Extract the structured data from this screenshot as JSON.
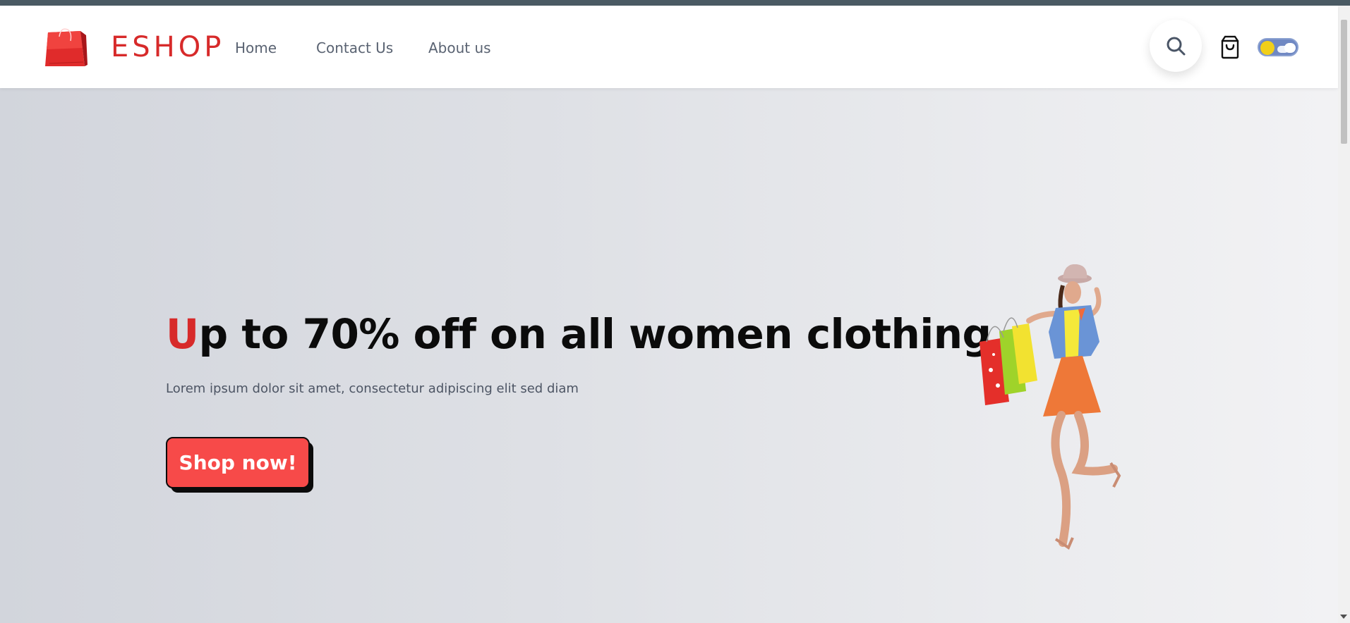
{
  "brand": {
    "name": "ESHOP",
    "logo_icon": "shopping-bag-icon",
    "color": "#d72a2a"
  },
  "nav": {
    "items": [
      {
        "label": "Home"
      },
      {
        "label": "Contact Us"
      },
      {
        "label": "About us"
      }
    ]
  },
  "header_actions": {
    "search_icon": "search-icon",
    "cart_icon": "cart-bag-icon",
    "theme_toggle": {
      "icon": "sun-cloud-toggle",
      "state": "light"
    }
  },
  "hero": {
    "headline_first_letter": "U",
    "headline_rest": "p to 70% off on all women clothing",
    "subtext": "Lorem ipsum dolor sit amet, consectetur adipiscing elit sed diam",
    "cta_label": "Shop now!",
    "cta_color": "#f74a49",
    "image": "woman-with-shopping-bags"
  }
}
